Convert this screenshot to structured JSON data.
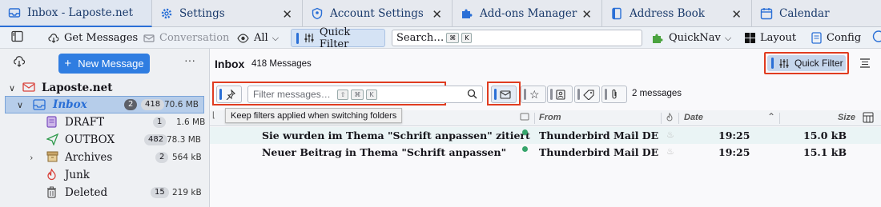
{
  "tabs": [
    {
      "label": "Inbox - Laposte.net",
      "icon": "inbox-icon"
    },
    {
      "label": "Settings",
      "icon": "gear-icon"
    },
    {
      "label": "Account Settings",
      "icon": "account-icon"
    },
    {
      "label": "Add-ons Manager",
      "icon": "puzzle-icon"
    },
    {
      "label": "Address Book",
      "icon": "address-book-icon"
    },
    {
      "label": "Calendar",
      "icon": "calendar-icon"
    }
  ],
  "toolbar": {
    "get_messages": "Get Messages",
    "conversation": "Conversation",
    "all": "All",
    "quick_filter": "Quick Filter",
    "search_placeholder": "Search…",
    "search_kbd1": "⌘",
    "search_kbd2": "K",
    "quicknav": "QuickNav",
    "layout": "Layout",
    "config": "Config"
  },
  "folder_pane": {
    "new_message": "New Message",
    "more": "···",
    "folders": [
      {
        "name": "Laposte.net",
        "unread": "",
        "count": "",
        "size": ""
      },
      {
        "name": "Inbox",
        "unread": "2",
        "count": "418",
        "size": "70.6 MB"
      },
      {
        "name": "DRAFT",
        "unread": "",
        "count": "1",
        "size": "1.6 MB"
      },
      {
        "name": "OUTBOX",
        "unread": "",
        "count": "482",
        "size": "78.3 MB"
      },
      {
        "name": "Archives",
        "unread": "",
        "count": "2",
        "size": "564 kB"
      },
      {
        "name": "Junk",
        "unread": "",
        "count": "",
        "size": ""
      },
      {
        "name": "Deleted",
        "unread": "",
        "count": "15",
        "size": "219 kB"
      }
    ]
  },
  "main": {
    "title": "Inbox",
    "message_count": "418 Messages",
    "quick_filter_label": "Quick Filter",
    "filter_placeholder": "Filter messages…",
    "filter_kbd": [
      "⇧",
      "⌘",
      "K"
    ],
    "filter_result": "2 messages",
    "tooltip": "Keep filters applied when switching folders",
    "columns": {
      "from": "From",
      "date": "Date",
      "size": "Size"
    },
    "messages": [
      {
        "subject": "Sie wurden im Thema \"Schrift anpassen\" zitiert",
        "from": "Thunderbird Mail DE",
        "date": "19:25",
        "size": "15.0 kB"
      },
      {
        "subject": "Neuer Beitrag in Thema \"Schrift anpassen\"",
        "from": "Thunderbird Mail DE",
        "date": "19:25",
        "size": "15.1 kB"
      }
    ]
  },
  "colors": {
    "accent": "#2f7de1",
    "highlight": "#e03c20",
    "selection": "#b6cdea"
  }
}
